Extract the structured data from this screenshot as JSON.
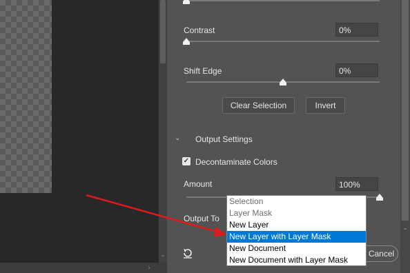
{
  "panel": {
    "contrast": {
      "label": "Contrast",
      "value": "0%",
      "level": 0
    },
    "shift_edge": {
      "label": "Shift Edge",
      "value": "0%",
      "level": 0.5
    },
    "buttons": {
      "clear_selection": "Clear Selection",
      "invert": "Invert"
    },
    "output_settings": {
      "title": "Output Settings",
      "decontaminate": {
        "label": "Decontaminate Colors",
        "checked": true
      },
      "amount": {
        "label": "Amount",
        "value": "100%",
        "level": 1.0
      },
      "output_to": {
        "label": "Output To"
      }
    },
    "cancel_label": "Cancel"
  },
  "dropdown": {
    "options": [
      {
        "label": "Selection",
        "enabled": false
      },
      {
        "label": "Layer Mask",
        "enabled": false
      },
      {
        "label": "New Layer",
        "enabled": true
      },
      {
        "label": "New Layer with Layer Mask",
        "enabled": true,
        "selected": true
      },
      {
        "label": "New Document",
        "enabled": true
      },
      {
        "label": "New Document with Layer Mask",
        "enabled": true
      }
    ]
  },
  "icons": {
    "reset": "reset-icon",
    "chevron": "chevron-down-icon",
    "checkbox": "checkmark-icon"
  },
  "colors": {
    "accent": "#0078d7",
    "annotation_arrow": "#e01b1b"
  }
}
